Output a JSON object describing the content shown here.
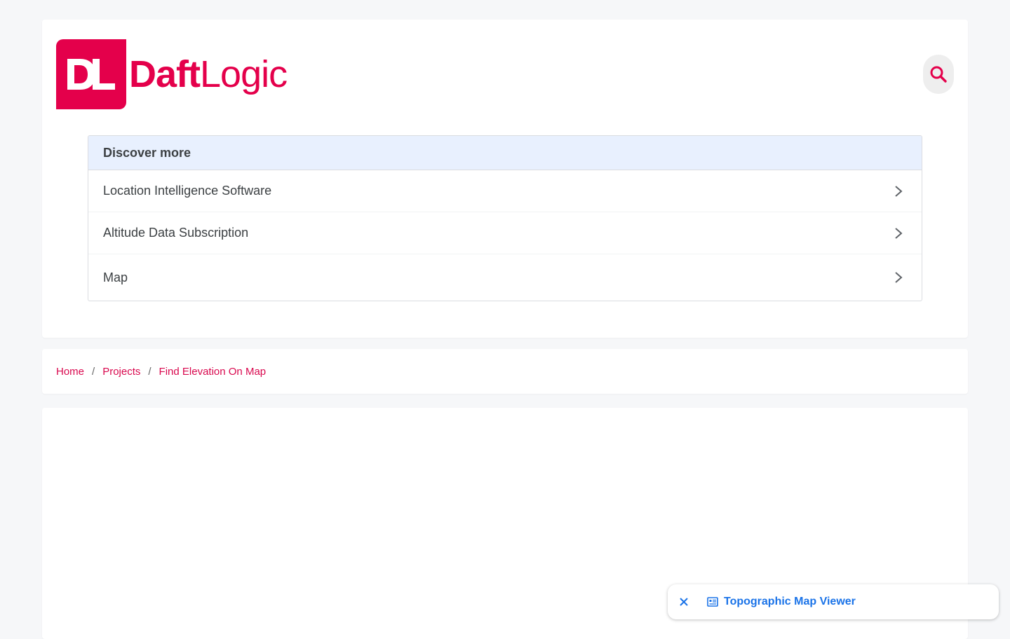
{
  "header": {
    "logo_bold": "Daft",
    "logo_light": "Logic"
  },
  "discover": {
    "title": "Discover more",
    "items": [
      {
        "label": "Location Intelligence Software"
      },
      {
        "label": "Altitude Data Subscription"
      },
      {
        "label": "Map"
      }
    ]
  },
  "breadcrumb": {
    "items": [
      {
        "label": "Home"
      },
      {
        "label": "Projects"
      },
      {
        "label": "Find Elevation On Map"
      }
    ],
    "separator": "/"
  },
  "banner": {
    "link_label": "Topographic Map Viewer"
  },
  "colors": {
    "brand": "#e4004b",
    "link": "#d9084e",
    "banner_link": "#1a73e8"
  },
  "icons": {
    "search": "search-icon",
    "chevron": "chevron-right-icon",
    "close": "close-icon",
    "article": "article-icon"
  }
}
